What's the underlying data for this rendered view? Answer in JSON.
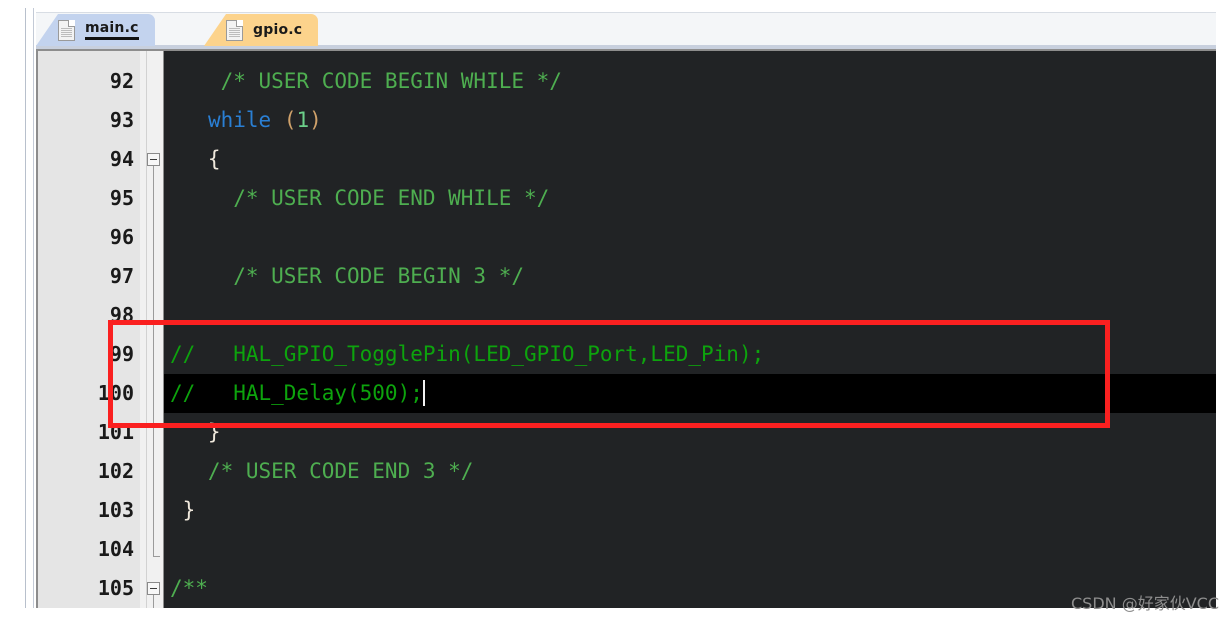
{
  "window": {
    "editor_background": "#212325",
    "gutter_background": "#e5e5e5"
  },
  "tabs": [
    {
      "label": "main.c",
      "active": true,
      "color": "#c3d3ee",
      "icon": "file-icon"
    },
    {
      "label": "gpio.c",
      "active": false,
      "color": "#fcd38c",
      "icon": "file-icon"
    }
  ],
  "editor": {
    "first_line": 92,
    "lines": [
      {
        "number": "92",
        "indent": 4,
        "text": "/* USER CODE BEGIN WHILE */"
      },
      {
        "number": "93",
        "indent": 3,
        "text": "while (1)"
      },
      {
        "number": "94",
        "indent": 3,
        "text": "{"
      },
      {
        "number": "95",
        "indent": 5,
        "text": "/* USER CODE END WHILE */"
      },
      {
        "number": "96",
        "indent": 0,
        "text": ""
      },
      {
        "number": "97",
        "indent": 5,
        "text": "/* USER CODE BEGIN 3 */"
      },
      {
        "number": "98",
        "indent": 0,
        "text": ""
      },
      {
        "number": "99",
        "indent": 0,
        "text": "//   HAL_GPIO_TogglePin(LED_GPIO_Port,LED_Pin);"
      },
      {
        "number": "100",
        "indent": 0,
        "text": "//   HAL_Delay(500);"
      },
      {
        "number": "101",
        "indent": 3,
        "text": "}"
      },
      {
        "number": "102",
        "indent": 3,
        "text": "/* USER CODE END 3 */"
      },
      {
        "number": "103",
        "indent": 1,
        "text": "}"
      },
      {
        "number": "104",
        "indent": 0,
        "text": ""
      },
      {
        "number": "105",
        "indent": 0,
        "text": "/**"
      }
    ],
    "current_line": "100",
    "cursor_after": "//   HAL_Delay(500);"
  },
  "annotation": {
    "box_color": "#fa2020",
    "covers_lines": "99-100"
  },
  "watermark": {
    "text": "CSDN @好家伙VCC"
  }
}
